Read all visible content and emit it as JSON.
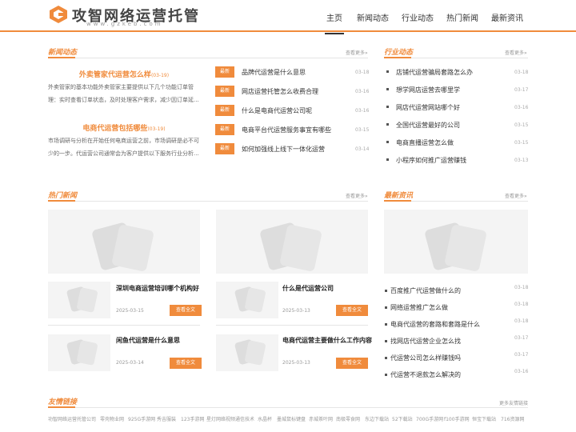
{
  "brand": {
    "name": "攻智网络运营托管",
    "domain": "www.gzkeb.com",
    "accent": "#f08b3c"
  },
  "nav": [
    "主页",
    "新闻动态",
    "行业动态",
    "热门新闻",
    "最新资讯"
  ],
  "news": {
    "title": "新闻动态",
    "more": "查看更多»",
    "featured": [
      {
        "title": "外卖管家代运营怎么样",
        "date": "(03-19)",
        "summary": "外卖管家的基本功能外卖管家主要提供以下几个功能订单管理：实时查看订单状态，及时处理客户需求，减少因订单延..."
      },
      {
        "title": "电商代运营包括哪些",
        "date": "(03-19)",
        "summary": "市场调研与分析在开始任何电商运营之前，市场调研是必不可少的一步。代运营公司通常会为客户提供以下服务行业分析..."
      }
    ],
    "badge": "最新",
    "list": [
      {
        "title": "品牌代运营是什么意思",
        "date": "03-18"
      },
      {
        "title": "网店运营托管怎么收费合理",
        "date": "03-16"
      },
      {
        "title": "什么是电商代运营公司呢",
        "date": "03-16"
      },
      {
        "title": "电商平台代运营服务事宜有哪些",
        "date": "03-15"
      },
      {
        "title": "如何加强线上线下一体化运营",
        "date": "03-14"
      }
    ]
  },
  "industry": {
    "title": "行业动态",
    "more": "查看更多»",
    "list": [
      {
        "title": "店铺代运营骗局套路怎么办",
        "date": "03-18"
      },
      {
        "title": "想学网店运营去哪里学",
        "date": "03-17"
      },
      {
        "title": "网店代运营网站哪个好",
        "date": "03-16"
      },
      {
        "title": "全国代运营最好的公司",
        "date": "03-15"
      },
      {
        "title": "电商直播运营怎么做",
        "date": "03-15"
      },
      {
        "title": "小程序如何推广运营赚钱",
        "date": "03-13"
      }
    ]
  },
  "hot": {
    "title": "热门新闻",
    "more": "查看更多»",
    "button": "查看全文",
    "cards": [
      {
        "title": "深圳电商运营培训哪个机构好",
        "date": "2025-03-15"
      },
      {
        "title": "什么是代运营公司",
        "date": "2025-03-13"
      },
      {
        "title": "闲鱼代运营是什么意思",
        "date": "2025-03-14"
      },
      {
        "title": "电商代运营主要做什么工作内容",
        "date": "2025-03-13"
      }
    ]
  },
  "latest": {
    "title": "最新资讯",
    "more": "查看更多»",
    "list": [
      {
        "title": "百度推广代运营做什么的",
        "date": "03-18"
      },
      {
        "title": "网络运营推广怎么做",
        "date": "03-18"
      },
      {
        "title": "电商代运营的套路和套路是什么",
        "date": "03-18"
      },
      {
        "title": "找网店代运营企业怎么找",
        "date": "03-17"
      },
      {
        "title": "代运营公司怎么样赚钱吗",
        "date": "03-17"
      },
      {
        "title": "代运营不退款怎么解决的",
        "date": "03-16"
      }
    ]
  },
  "links": {
    "title": "友情链接",
    "more": "更多友情链接",
    "items": [
      "功智网络运营托管公司",
      "零壳物业网",
      "925G手游网",
      "秀吉服装",
      "123手游网",
      "星灯网络视频通信技术",
      "水晶杯",
      "墨城鼠标键盘",
      "赤城茶叶网",
      "南极零食网",
      "东边下载站",
      "52下载站",
      "700G手游网",
      "f100手游网",
      "恒宝下载站",
      "716资源网"
    ]
  }
}
